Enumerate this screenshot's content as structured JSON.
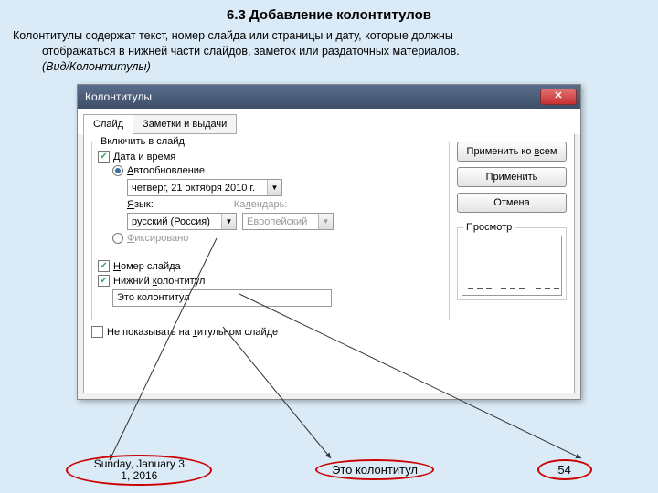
{
  "heading": "6.3 Добавление колонтитулов",
  "description_line1": "Колонтитулы содержат текст, номер слайда или страницы и дату, которые должны",
  "description_line2": "отображаться в нижней части слайдов, заметок или раздаточных материалов.",
  "description_line3": "(Вид/Колонтитулы)",
  "dialog": {
    "title": "Колонтитулы",
    "tabs": {
      "slide": "Слайд",
      "notes": "Заметки и выдачи"
    },
    "group_title": "Включить в слайд",
    "datetime": "Дата и время",
    "auto_update": "Автообновление",
    "date_value": "четверг, 21 октября 2010 г.",
    "lang_label": "Язык:",
    "lang_value": "русский (Россия)",
    "cal_label": "Календарь:",
    "cal_value": "Европейский",
    "fixed": "Фиксировано",
    "slide_num": "Номер слайда",
    "footer": "Нижний колонтитул",
    "footer_text": "Это колонтитул",
    "no_title": "Не показывать на титульном слайде",
    "btn_apply_all": "Применить ко всем",
    "btn_apply": "Применить",
    "btn_cancel": "Отмена",
    "preview": "Просмотр"
  },
  "footer_ovals": {
    "date": "Sunday, January 31, 2016",
    "text": "Это колонтитул",
    "num": "54"
  }
}
